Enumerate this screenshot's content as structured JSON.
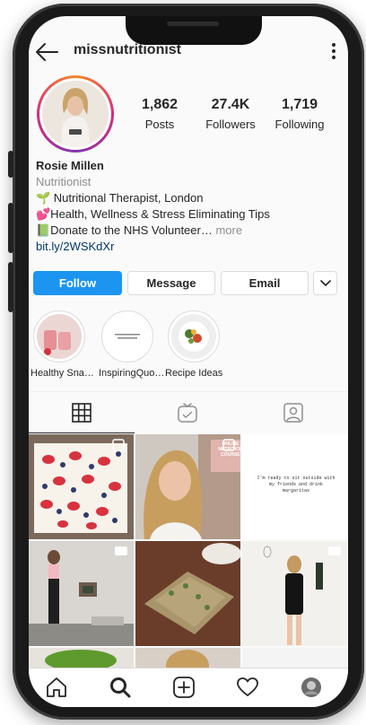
{
  "header": {
    "username": "missnutritionist"
  },
  "stats": [
    {
      "value": "1,862",
      "label": "Posts"
    },
    {
      "value": "27.4K",
      "label": "Followers"
    },
    {
      "value": "1,719",
      "label": "Following"
    }
  ],
  "bio": {
    "name": "Rosie Millen",
    "category": "Nutritionist",
    "line1": "🌱 Nutritional Therapist, London",
    "line2": "💕Health, Wellness & Stress Eliminating Tips",
    "line3": "📗Donate to the NHS Volunteer…",
    "more": " more",
    "link": "bit.ly/2WSKdXr"
  },
  "buttons": {
    "follow": "Follow",
    "message": "Message",
    "email": "Email"
  },
  "highlights": [
    {
      "label": "Healthy Sna…"
    },
    {
      "label": "InspiringQuo…"
    },
    {
      "label": "Recipe Ideas"
    }
  ],
  "posts": {
    "quote": "I'm ready to sit outside with my friends and drink margaritas",
    "overlay": "ONLINE NUTRITION COURSE"
  },
  "colors": {
    "follow_blue": "#1c95f0",
    "link": "#00376b",
    "text": "#262626",
    "muted": "#8e8e8e"
  }
}
